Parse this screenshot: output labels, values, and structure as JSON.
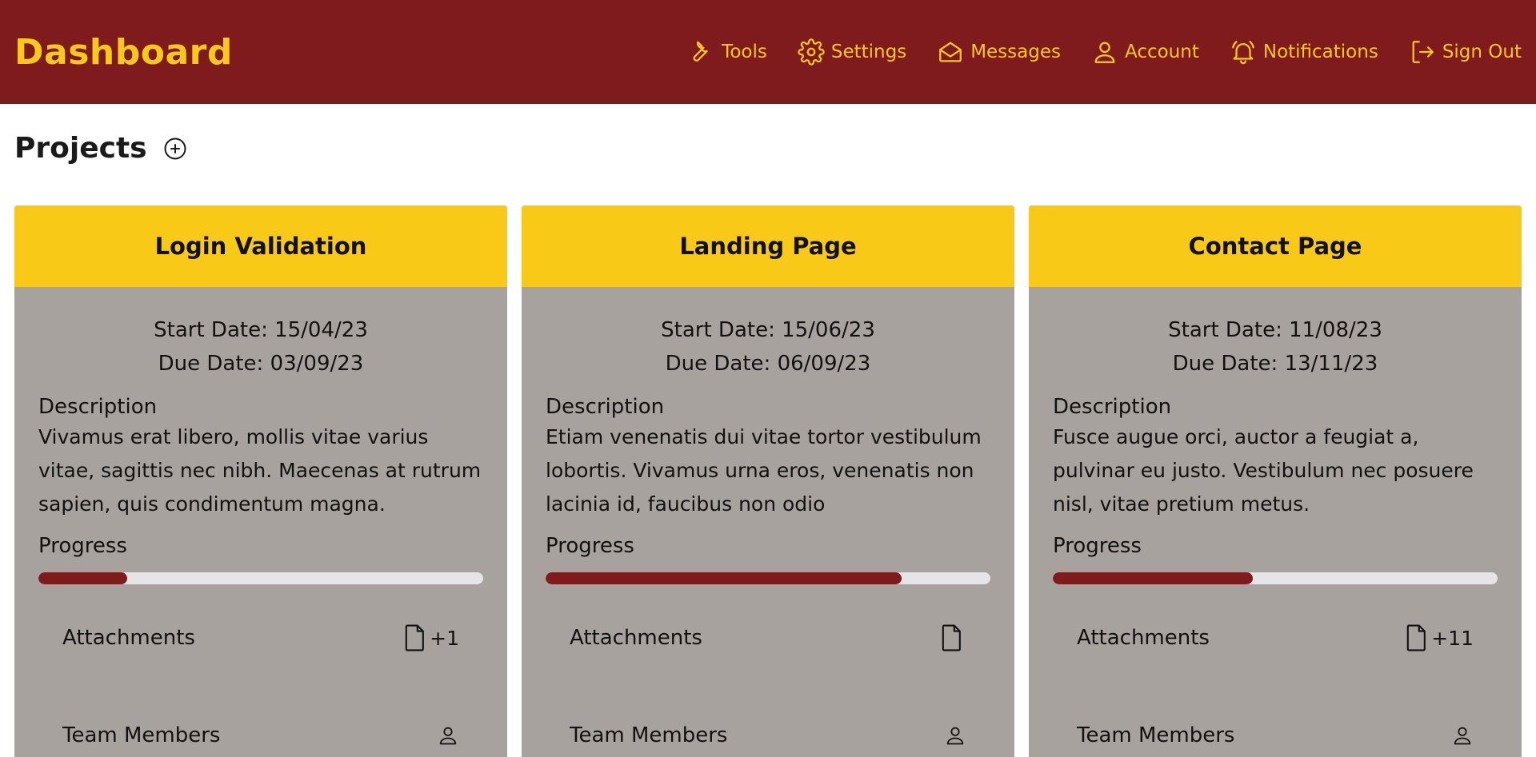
{
  "header": {
    "title": "Dashboard",
    "nav": [
      {
        "label": "Tools",
        "icon": "wrench-icon"
      },
      {
        "label": "Settings",
        "icon": "gear-icon"
      },
      {
        "label": "Messages",
        "icon": "envelope-open-icon"
      },
      {
        "label": "Account",
        "icon": "user-icon"
      },
      {
        "label": "Notifications",
        "icon": "bell-icon"
      },
      {
        "label": "Sign Out",
        "icon": "sign-out-icon"
      }
    ]
  },
  "colors": {
    "primary": "#7f1a1d",
    "accent": "#f8c918",
    "card_bg": "#a8a29e",
    "track": "#e5e5e7"
  },
  "projects": {
    "title": "Projects",
    "add_icon": "plus-circle-icon",
    "items": [
      {
        "name": "Login Validation",
        "start": "Start Date: 15/04/23",
        "due": "Due Date: 03/09/23",
        "description_label": "Description",
        "description": "Vivamus erat libero, mollis vitae varius vitae, sagittis nec nibh. Maecenas at rutrum sapien, quis condimentum magna.",
        "progress_label": "Progress",
        "progress": 0.2,
        "attachments_label": "Attachments",
        "attachments_count": "+1",
        "team_label": "Team Members"
      },
      {
        "name": "Landing Page",
        "start": "Start Date: 15/06/23",
        "due": "Due Date: 06/09/23",
        "description_label": "Description",
        "description": "Etiam venenatis dui vitae tortor vestibulum lobortis. Vivamus urna eros, venenatis non lacinia id, faucibus non odio",
        "progress_label": "Progress",
        "progress": 0.8,
        "attachments_label": "Attachments",
        "attachments_count": "",
        "team_label": "Team Members"
      },
      {
        "name": "Contact Page",
        "start": "Start Date: 11/08/23",
        "due": "Due Date: 13/11/23",
        "description_label": "Description",
        "description": "Fusce augue orci, auctor a feugiat a, pulvinar eu justo. Vestibulum nec posuere nisl, vitae pretium metus.",
        "progress_label": "Progress",
        "progress": 0.45,
        "attachments_label": "Attachments",
        "attachments_count": "+11",
        "team_label": "Team Members"
      }
    ]
  }
}
